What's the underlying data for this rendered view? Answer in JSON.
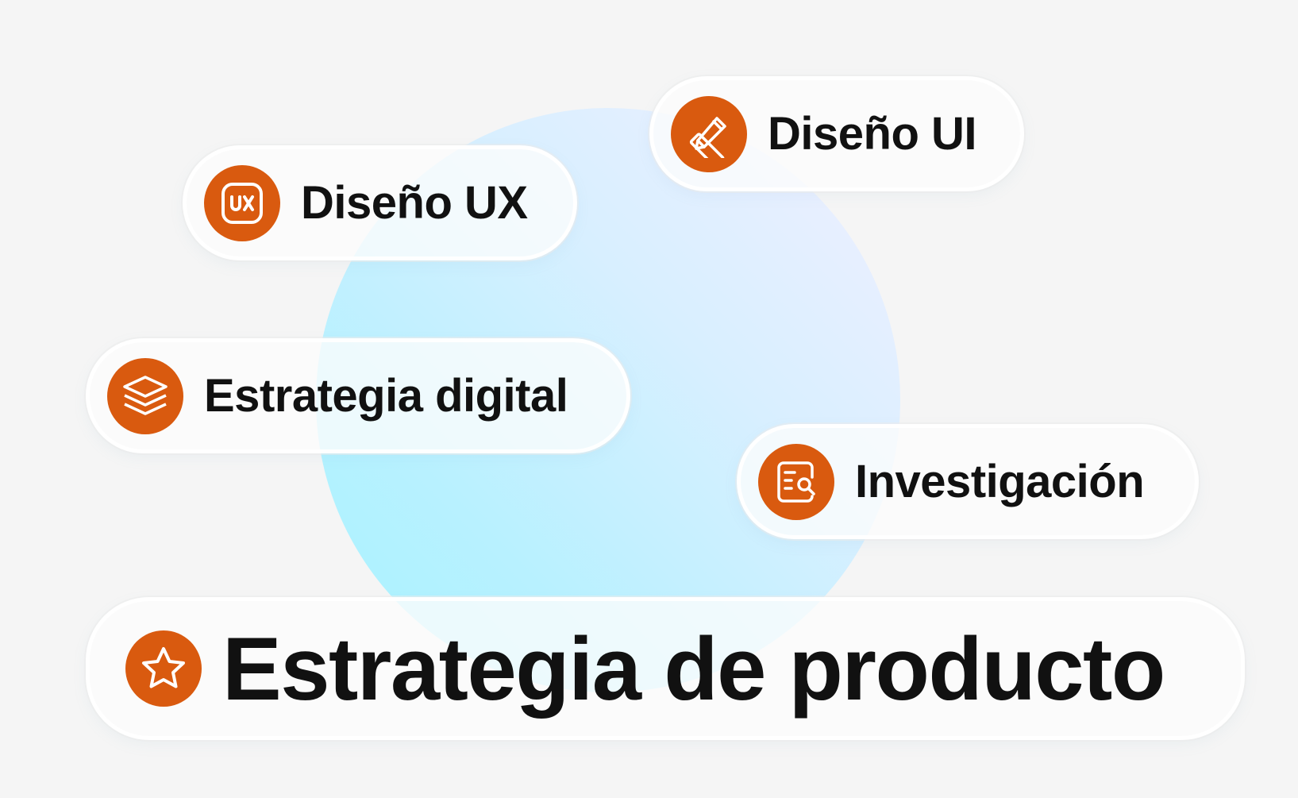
{
  "colors": {
    "background": "#f5f5f5",
    "accent": "#d95a0f",
    "text": "#111111",
    "blob_gradient": [
      "#f1efff",
      "#d8efff",
      "#b8f1ff",
      "#a6f3ff"
    ]
  },
  "tags": {
    "ux": {
      "label": "Diseño UX",
      "icon": "ux-icon"
    },
    "ui": {
      "label": "Diseño UI",
      "icon": "pencil-ruler-icon"
    },
    "digital": {
      "label": "Estrategia digital",
      "icon": "layers-icon"
    },
    "research": {
      "label": "Investigación",
      "icon": "document-search-icon"
    }
  },
  "main": {
    "label": "Estrategia de producto",
    "icon": "star-icon"
  }
}
